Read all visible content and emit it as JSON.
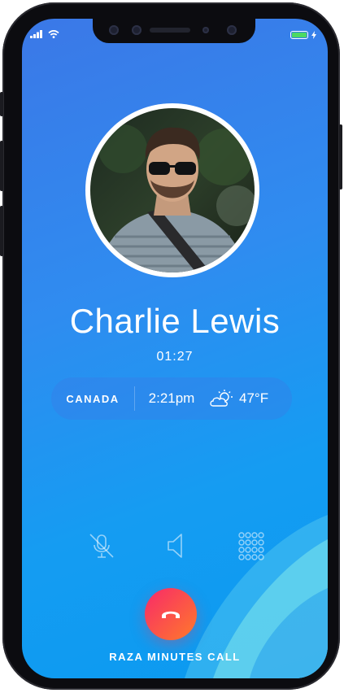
{
  "status_bar": {
    "signal_icon": "signal-bars-icon",
    "wifi_icon": "wifi-icon",
    "battery_icon": "battery-icon",
    "battery_level": 1.0,
    "charging_icon": "bolt-icon",
    "battery_color": "#4cd964"
  },
  "caller": {
    "name": "Charlie Lewis",
    "duration": "01:27",
    "avatar": "caller-photo"
  },
  "info": {
    "country": "CANADA",
    "local_time": "2:21pm",
    "weather_icon": "partly-cloudy-icon",
    "temperature": "47°F"
  },
  "controls": [
    {
      "name": "mute",
      "icon": "microphone-off-icon"
    },
    {
      "name": "speaker",
      "icon": "speaker-icon"
    },
    {
      "name": "keypad",
      "icon": "keypad-icon"
    }
  ],
  "end_call": {
    "icon": "phone-hangup-icon",
    "gradient_start": "#f8296a",
    "gradient_end": "#ff7a2a"
  },
  "footer": {
    "brand_label": "RAZA MINUTES CALL"
  },
  "colors": {
    "background_top": "#3b78e7",
    "background_bottom": "#0a9af0",
    "wave_light": "#5fd6ea"
  }
}
